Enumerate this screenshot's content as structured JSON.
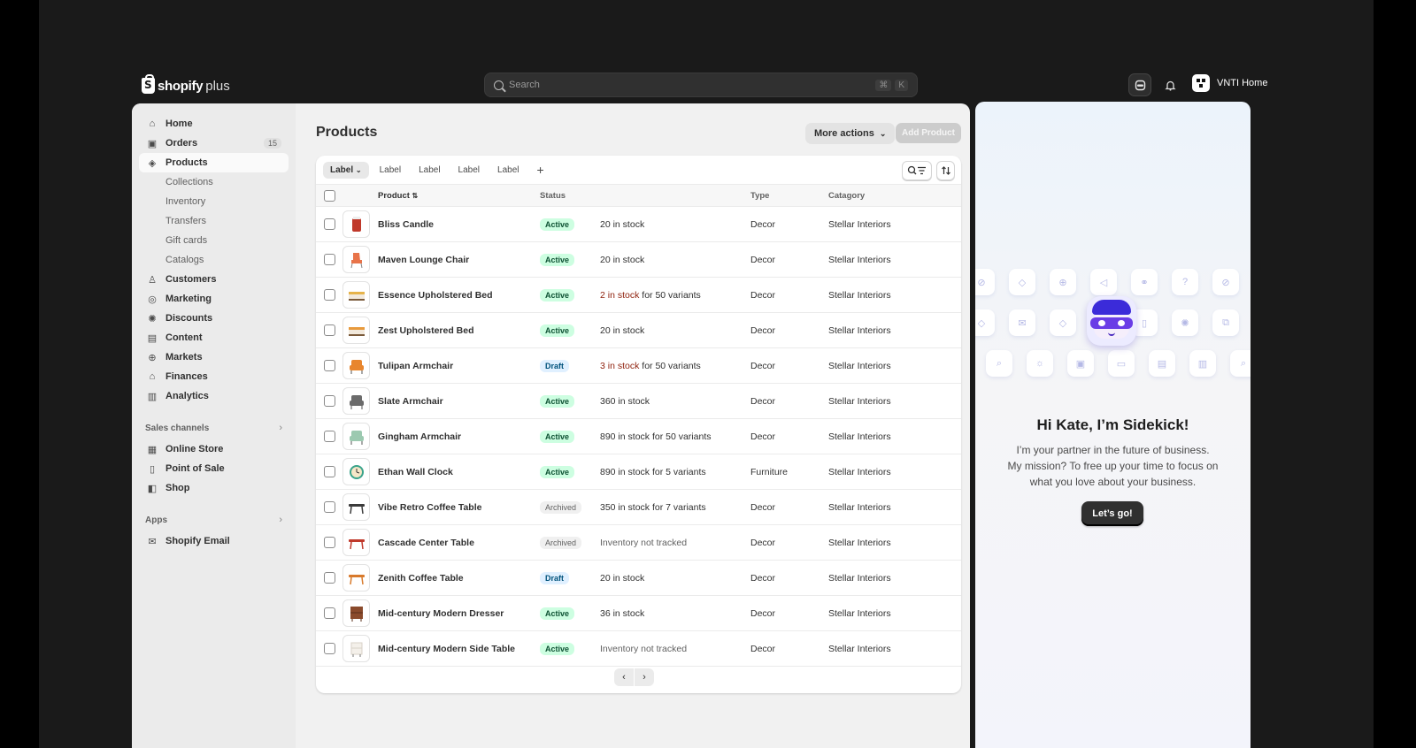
{
  "header": {
    "logo_word": "shopify",
    "logo_suffix": "plus",
    "search_placeholder": "Search",
    "search_shortcut": [
      "⌘",
      "K"
    ],
    "store_name": "VNTI Home"
  },
  "sidebar": {
    "items": [
      {
        "label": "Home",
        "icon": "home-icon",
        "glyph": "⌂"
      },
      {
        "label": "Orders",
        "icon": "inbox-icon",
        "glyph": "▣",
        "count": "15"
      },
      {
        "label": "Products",
        "icon": "tag-icon",
        "glyph": "◈",
        "active": true
      },
      {
        "label": "Collections",
        "sub": true
      },
      {
        "label": "Inventory",
        "sub": true
      },
      {
        "label": "Transfers",
        "sub": true
      },
      {
        "label": "Gift cards",
        "sub": true
      },
      {
        "label": "Catalogs",
        "sub": true
      },
      {
        "label": "Customers",
        "icon": "person-icon",
        "glyph": "♙"
      },
      {
        "label": "Marketing",
        "icon": "target-icon",
        "glyph": "◎"
      },
      {
        "label": "Discounts",
        "icon": "discount-icon",
        "glyph": "✺"
      },
      {
        "label": "Content",
        "icon": "content-icon",
        "glyph": "▤"
      },
      {
        "label": "Markets",
        "icon": "globe-icon",
        "glyph": "⊕"
      },
      {
        "label": "Finances",
        "icon": "bank-icon",
        "glyph": "⌂"
      },
      {
        "label": "Analytics",
        "icon": "bar-chart-icon",
        "glyph": "▥"
      }
    ],
    "sales_channels": {
      "title": "Sales channels",
      "items": [
        {
          "label": "Online Store",
          "icon": "store-icon",
          "glyph": "▦"
        },
        {
          "label": "Point of Sale",
          "icon": "pos-icon",
          "glyph": "▯"
        },
        {
          "label": "Shop",
          "icon": "shop-icon",
          "glyph": "◧"
        }
      ]
    },
    "apps": {
      "title": "Apps",
      "items": [
        {
          "label": "Shopify Email",
          "icon": "email-icon",
          "glyph": "✉"
        }
      ]
    }
  },
  "page": {
    "title": "Products",
    "more_actions": "More actions",
    "add_product": "Add Product",
    "tabs": [
      "Label",
      "Label",
      "Label",
      "Label",
      "Label"
    ],
    "columns": {
      "product": "Product",
      "status": "Status",
      "type": "Type",
      "category": "Catagory"
    },
    "rows": [
      {
        "name": "Bliss Candle",
        "status": "Active",
        "inv_red": "",
        "inv": "20 in stock",
        "type": "Decor",
        "category": "Stellar Interiors",
        "thumb": "candle",
        "color": "#c0392b"
      },
      {
        "name": "Maven Lounge Chair",
        "status": "Active",
        "inv_red": "",
        "inv": "20 in stock",
        "type": "Decor",
        "category": "Stellar Interiors",
        "thumb": "chair",
        "color": "#e8744a"
      },
      {
        "name": "Essence Upholstered Bed",
        "status": "Active",
        "inv_red": "2 in stock",
        "inv": " for 50 variants",
        "type": "Decor",
        "category": "Stellar Interiors",
        "thumb": "bed",
        "color": "#e6b34a"
      },
      {
        "name": "Zest Upholstered Bed",
        "status": "Active",
        "inv_red": "",
        "inv": "20 in stock",
        "type": "Decor",
        "category": "Stellar Interiors",
        "thumb": "bed",
        "color": "#e89a3c"
      },
      {
        "name": "Tulipan Armchair",
        "status": "Draft",
        "inv_red": "3 in stock",
        "inv": " for 50 variants",
        "type": "Decor",
        "category": "Stellar Interiors",
        "thumb": "armchair",
        "color": "#e8862e"
      },
      {
        "name": "Slate Armchair",
        "status": "Active",
        "inv_red": "",
        "inv": "360 in stock",
        "type": "Decor",
        "category": "Stellar Interiors",
        "thumb": "armchair",
        "color": "#6b6b6b"
      },
      {
        "name": "Gingham Armchair",
        "status": "Active",
        "inv_red": "",
        "inv": "890 in stock for 50 variants",
        "type": "Decor",
        "category": "Stellar Interiors",
        "thumb": "armchair",
        "color": "#9cc9b0"
      },
      {
        "name": "Ethan Wall Clock",
        "status": "Active",
        "inv_red": "",
        "inv": "890 in stock for 5 variants",
        "type": "Furniture",
        "category": "Stellar Interiors",
        "thumb": "clock",
        "color": "#3aa38a"
      },
      {
        "name": "Vibe Retro Coffee Table",
        "status": "Archived",
        "inv_red": "",
        "inv": "350 in stock for 7 variants",
        "type": "Decor",
        "category": "Stellar Interiors",
        "thumb": "table",
        "color": "#3b3b3b"
      },
      {
        "name": "Cascade Center Table",
        "status": "Archived",
        "inv_red": "",
        "inv": "Inventory not tracked",
        "inv_grey": true,
        "type": "Decor",
        "category": "Stellar Interiors",
        "thumb": "table",
        "color": "#c0392b"
      },
      {
        "name": "Zenith Coffee Table",
        "status": "Draft",
        "inv_red": "",
        "inv": "20 in stock",
        "type": "Decor",
        "category": "Stellar Interiors",
        "thumb": "table",
        "color": "#d87a2c"
      },
      {
        "name": "Mid-century Modern Dresser",
        "status": "Active",
        "inv_red": "",
        "inv": "36 in stock",
        "type": "Decor",
        "category": "Stellar Interiors",
        "thumb": "dresser",
        "color": "#8a4a2c"
      },
      {
        "name": "Mid-century Modern Side Table",
        "status": "Active",
        "inv_red": "",
        "inv": "Inventory not tracked",
        "inv_grey": true,
        "type": "Decor",
        "category": "Stellar Interiors",
        "thumb": "sidetable",
        "color": "#d8d2c8"
      }
    ]
  },
  "sidekick": {
    "title": "Hi Kate, I’m Sidekick!",
    "lines": [
      "I’m your partner in the future of business.",
      "My mission? To free up your time to focus on",
      "what you love about your business."
    ],
    "button": "Let’s go!"
  }
}
